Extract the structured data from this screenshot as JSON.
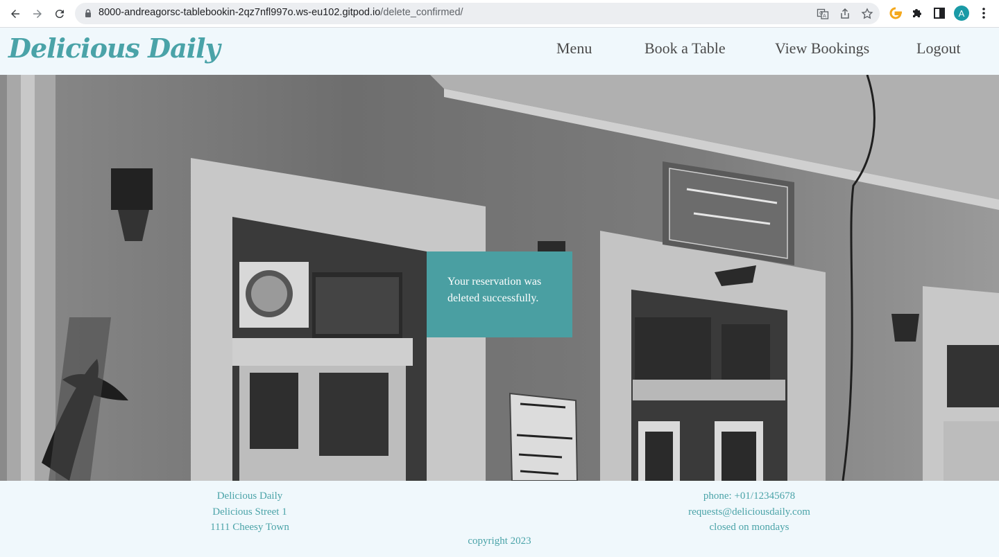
{
  "browser": {
    "url_host": "8000-andreagorsc-tablebookin-2qz7nfl997o.ws-eu102.gitpod.io",
    "url_path": "/delete_confirmed/",
    "profile_initial": "A",
    "icons": [
      "back-icon",
      "forward-icon",
      "reload-icon",
      "lock-icon",
      "translate-icon",
      "share-icon",
      "star-icon",
      "extension-g-icon",
      "puzzle-icon",
      "sidepanel-icon",
      "kebab-menu-icon"
    ]
  },
  "header": {
    "brand": "Delicious Daily",
    "nav": [
      "Menu",
      "Book a Table",
      "View Bookings",
      "Logout"
    ]
  },
  "message": {
    "text": "Your reservation was deleted successfully."
  },
  "footer": {
    "left": [
      "Delicious Daily",
      "Delicious Street 1",
      "1111 Cheesy Town"
    ],
    "right": [
      "phone: +01/12345678",
      "requests@deliciousdaily.com",
      "closed on mondays"
    ],
    "copyright": "copyright 2023"
  },
  "colors": {
    "accent": "#4aa3a8",
    "message_bg": "#4a9fa2",
    "header_bg": "#f0f8fc"
  }
}
